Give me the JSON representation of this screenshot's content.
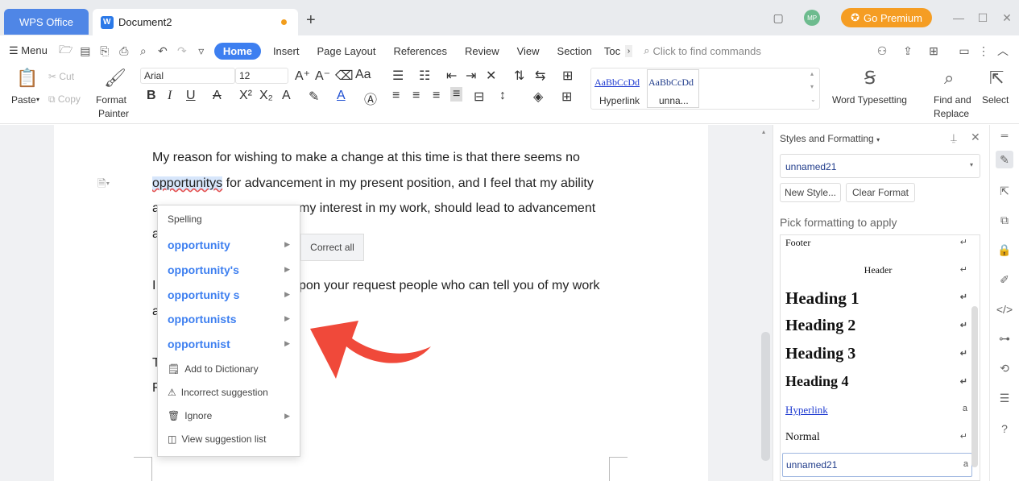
{
  "titlebar": {
    "wps_tab": "WPS Office",
    "doc_tab": "Document2",
    "new_tab": "+",
    "avatar": "MP",
    "premium": "Go Premium"
  },
  "menubar": {
    "menu": "Menu",
    "tabs": [
      "Home",
      "Insert",
      "Page Layout",
      "References",
      "Review",
      "View",
      "Section",
      "Toc"
    ],
    "find_placeholder": "Click to find commands"
  },
  "ribbon": {
    "paste": "Paste",
    "cut": "Cut",
    "copy": "Copy",
    "format_painter_1": "Format",
    "format_painter_2": "Painter",
    "font_name": "Arial",
    "font_size": "12",
    "style_preview_1": "AaBbCcDd",
    "style_preview_2": "AaBbCcDd",
    "style_label_1": "Hyperlink",
    "style_label_2": "unna...",
    "word_typesetting": "Word Typesetting",
    "find_replace_1": "Find and",
    "find_replace_2": "Replace",
    "select": "Select"
  },
  "document": {
    "line1": "My reason for wishing to make a change at this time is that there seems no",
    "misspelled": "opportunitys",
    "line2_rest": " for advancement in my present position, and I feel that my ability",
    "line3_visible": "my interest in my work, should lead to advancement",
    "line3_lead": "a",
    "line4_lead": "a",
    "line5_visible": "pon your request people who can tell you of my work",
    "line5_lead": "I",
    "line6_lead": "a",
    "line7_lead": "T",
    "line8_lead": "F"
  },
  "context_menu": {
    "header": "Spelling",
    "suggestions": [
      "opportunity",
      "opportunity's",
      "opportunity s",
      "opportunists",
      "opportunist"
    ],
    "add_dictionary": "Add to Dictionary",
    "incorrect": "Incorrect suggestion",
    "ignore": "Ignore",
    "view_list": "View suggestion list",
    "correct_all": "Correct all"
  },
  "styles_panel": {
    "title": "Styles and Formatting",
    "current_style": "unnamed21",
    "new_style": "New Style...",
    "clear_format": "Clear Format",
    "pick_label": "Pick formatting to apply",
    "styles": [
      {
        "name": "Footer",
        "mark": "↵"
      },
      {
        "name": "Header",
        "mark": "↵"
      },
      {
        "name": "Heading 1",
        "mark": "↵"
      },
      {
        "name": "Heading 2",
        "mark": "↵"
      },
      {
        "name": "Heading 3",
        "mark": "↵"
      },
      {
        "name": "Heading 4",
        "mark": "↵"
      },
      {
        "name": "Hyperlink",
        "mark": "a"
      },
      {
        "name": "Normal",
        "mark": "↵"
      },
      {
        "name": "unnamed21",
        "mark": "a"
      }
    ]
  },
  "colors": {
    "accent": "#3d7ff0",
    "premium": "#f59d23",
    "arrow": "#f0493a"
  }
}
